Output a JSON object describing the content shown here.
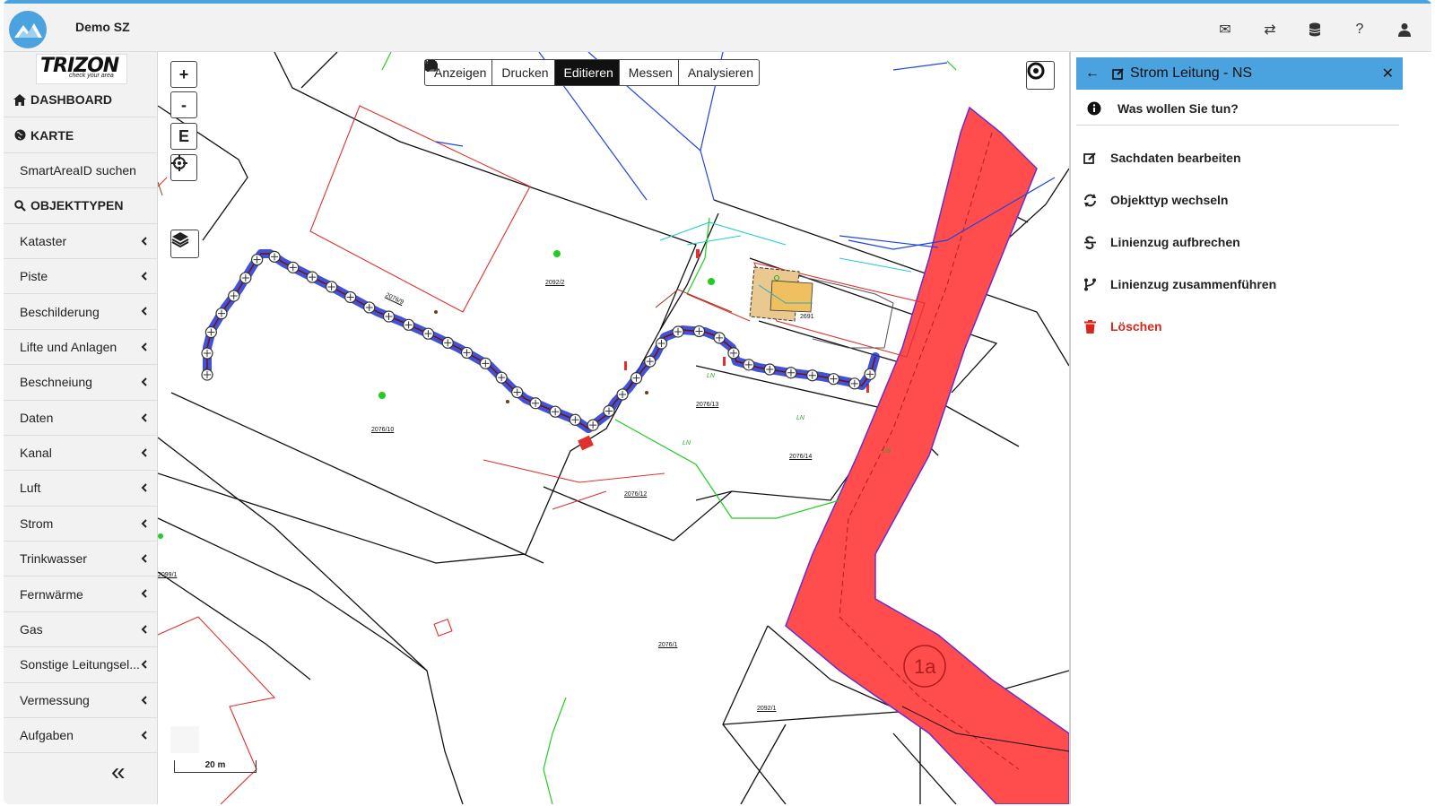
{
  "header": {
    "app_title": "Demo SZ",
    "icons": [
      "envelope-icon",
      "swap-icon",
      "database-icon",
      "help-icon",
      "user-icon"
    ]
  },
  "brand": {
    "name": "TRIZON",
    "tagline": "check your area"
  },
  "sidebar": {
    "items": [
      {
        "label": "DASHBOARD",
        "type": "head",
        "icon": "home-icon"
      },
      {
        "label": "KARTE",
        "type": "head",
        "icon": "globe-icon"
      },
      {
        "label": "SmartAreaID suchen",
        "type": "sub"
      },
      {
        "label": "OBJEKTTYPEN",
        "type": "head",
        "icon": "search-icon"
      },
      {
        "label": "Kataster",
        "type": "sub",
        "chevron": true
      },
      {
        "label": "Piste",
        "type": "sub",
        "chevron": true
      },
      {
        "label": "Beschilderung",
        "type": "sub",
        "chevron": true
      },
      {
        "label": "Lifte und Anlagen",
        "type": "sub",
        "chevron": true
      },
      {
        "label": "Beschneiung",
        "type": "sub",
        "chevron": true
      },
      {
        "label": "Daten",
        "type": "sub",
        "chevron": true
      },
      {
        "label": "Kanal",
        "type": "sub",
        "chevron": true
      },
      {
        "label": "Luft",
        "type": "sub",
        "chevron": true
      },
      {
        "label": "Strom",
        "type": "sub",
        "chevron": true
      },
      {
        "label": "Trinkwasser",
        "type": "sub",
        "chevron": true
      },
      {
        "label": "Fernwärme",
        "type": "sub",
        "chevron": true
      },
      {
        "label": "Gas",
        "type": "sub",
        "chevron": true
      },
      {
        "label": "Sonstige Leitungsel...",
        "type": "sub",
        "chevron": true
      },
      {
        "label": "Vermessung",
        "type": "sub",
        "chevron": true
      },
      {
        "label": "Aufgaben",
        "type": "sub",
        "chevron": true
      }
    ],
    "collapse_label": "«"
  },
  "map": {
    "zoom_in": "+",
    "zoom_out": "-",
    "extent": "E",
    "toolbar": [
      {
        "label": "Anzeigen",
        "icon": "eye-icon"
      },
      {
        "label": "Drucken",
        "icon": "printer-icon"
      },
      {
        "label": "Editieren",
        "icon": "pencil-icon",
        "active": true
      },
      {
        "label": "Messen",
        "icon": "ruler-icon"
      },
      {
        "label": "Analysieren",
        "icon": "chart-icon"
      }
    ],
    "scale": "20 m",
    "parcels": [
      "2092/2",
      "2076/9",
      "2076/10",
      "2076/13",
      "2076/14",
      "2076/12",
      "2076/1",
      "2092/1",
      "2099/1",
      "2691"
    ],
    "line_label": "LN",
    "zone_label": "1a"
  },
  "panel": {
    "title": "Strom Leitung - NS",
    "question": "Was wollen Sie tun?",
    "actions": [
      {
        "label": "Sachdaten bearbeiten",
        "icon": "edit-icon"
      },
      {
        "label": "Objekttyp wechseln",
        "icon": "refresh-icon"
      },
      {
        "label": "Linienzug aufbrechen",
        "icon": "strikethrough-icon"
      },
      {
        "label": "Linienzug zusammenführen",
        "icon": "merge-icon"
      },
      {
        "label": "Löschen",
        "icon": "trash-icon",
        "danger": true
      }
    ]
  },
  "colors": {
    "accent": "#4aa3df",
    "danger": "#d9261c",
    "zone": "#ff4d4d",
    "edit_line": "#2233cc"
  }
}
